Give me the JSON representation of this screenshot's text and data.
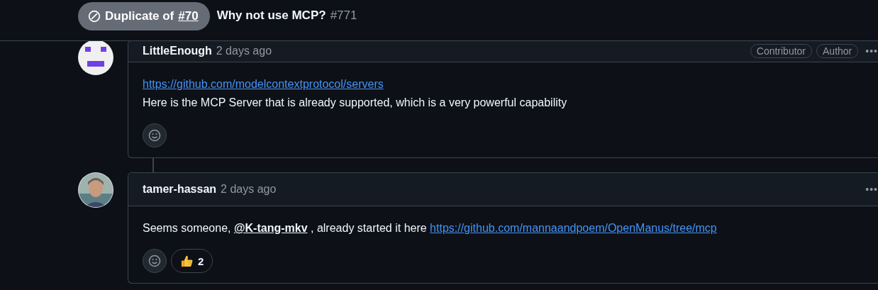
{
  "header": {
    "state_badge": {
      "label": "Duplicate of",
      "link": "#70"
    },
    "title": "Why not use MCP?",
    "number": "#771"
  },
  "comments": [
    {
      "author": "LittleEnough",
      "time": "2 days ago",
      "kind": "identicon",
      "badges": [
        "Contributor",
        "Author"
      ],
      "menu": "•••",
      "paragraphs": [
        [
          {
            "kind": "link",
            "text": "https://github.com/modelcontextprotocol/servers"
          }
        ],
        [
          {
            "kind": "text",
            "text": "Here is the MCP Server that is already supported, which is a very powerful capability"
          }
        ]
      ],
      "reactions": [
        {
          "kind": "add"
        }
      ]
    },
    {
      "author": "tamer-hassan",
      "time": "2 days ago",
      "kind": "photo",
      "menu": "•••",
      "paragraphs": [
        [
          {
            "kind": "text",
            "text": "Seems someone, "
          },
          {
            "kind": "mention",
            "text": "@K-tang-mkv"
          },
          {
            "kind": "text",
            "text": " , already started it here "
          },
          {
            "kind": "link",
            "text": "https://github.com/mannaandpoem/OpenManus/tree/mcp"
          }
        ]
      ],
      "reactions": [
        {
          "kind": "add"
        },
        {
          "kind": "thumbs_up",
          "count": "2"
        }
      ]
    }
  ]
}
